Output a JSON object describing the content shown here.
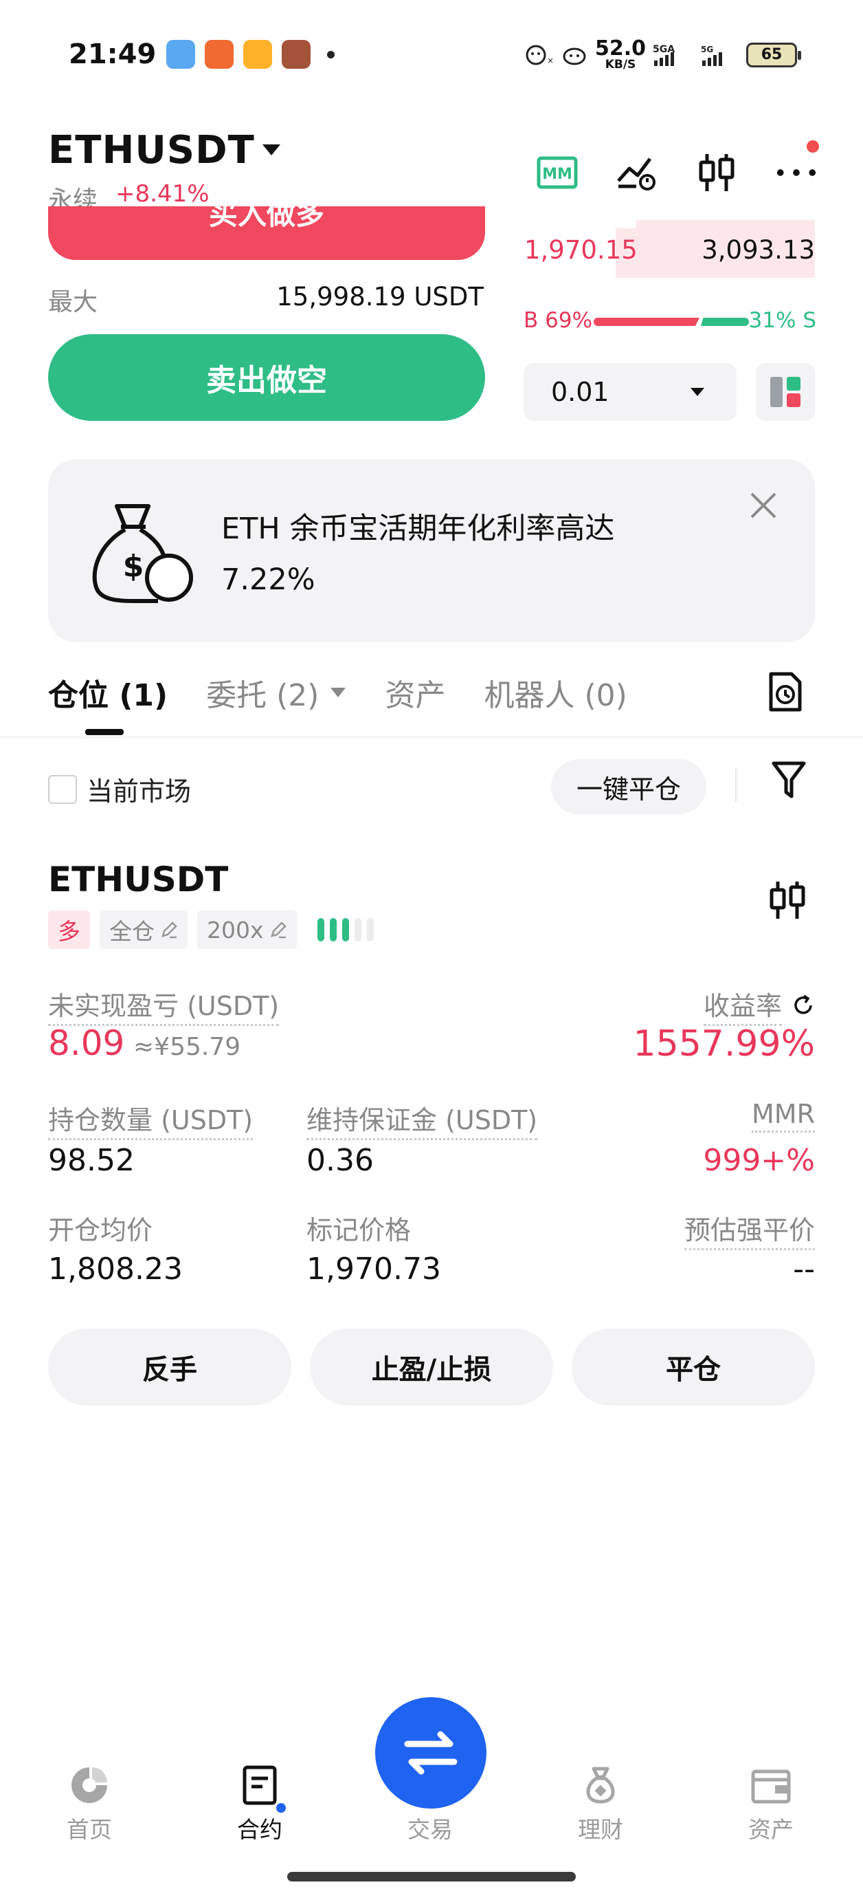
{
  "status_bar": {
    "time": "21:49",
    "net_speed": "52.0",
    "net_unit": "KB/S",
    "signal_1": "5GA",
    "signal_2": "5G",
    "battery": "65"
  },
  "header": {
    "pair": "ETHUSDT",
    "contract_type": "永续",
    "change_pct": "+8.41%"
  },
  "trade_panel": {
    "buy_label": "买入做多",
    "max_label": "最大",
    "max_value": "15,998.19 USDT",
    "sell_label": "卖出做空"
  },
  "orderbook": {
    "ask_price": "1,970.15",
    "ask_size": "3,093.13",
    "buy_ratio": "B 69%",
    "sell_ratio": "31% S",
    "depth_step": "0.01"
  },
  "promo": {
    "text_line1": "ETH 余币宝活期年化利率高达",
    "text_line2": "7.22%"
  },
  "tabs": {
    "positions": "仓位 (1)",
    "orders": "委托 (2)",
    "assets": "资产",
    "bots": "机器人 (0)"
  },
  "filter": {
    "current_market": "当前市场",
    "close_all": "一键平仓"
  },
  "position": {
    "symbol": "ETHUSDT",
    "side_tag": "多",
    "margin_mode": "全仓",
    "leverage": "200x",
    "pnl_label": "未实现盈亏 (USDT)",
    "pnl_value": "8.09",
    "pnl_cny": "≈¥55.79",
    "roe_label": "收益率",
    "roe_value": "1557.99%",
    "size_label": "持仓数量 (USDT)",
    "size_value": "98.52",
    "maint_margin_label": "维持保证金 (USDT)",
    "maint_margin_value": "0.36",
    "mmr_label": "MMR",
    "mmr_value": "999+%",
    "entry_label": "开仓均价",
    "entry_value": "1,808.23",
    "mark_label": "标记价格",
    "mark_value": "1,970.73",
    "liq_label": "预估强平价",
    "liq_value": "--"
  },
  "actions": {
    "reverse": "反手",
    "tpsl": "止盈/止损",
    "close": "平仓"
  },
  "nav": {
    "home": "首页",
    "futures": "合约",
    "trade": "交易",
    "earn": "理财",
    "assets": "资产"
  },
  "colors": {
    "red": "#e8375a",
    "green": "#2ebd85",
    "blue": "#1f63f1",
    "grey_bg": "#f3f3f5"
  }
}
